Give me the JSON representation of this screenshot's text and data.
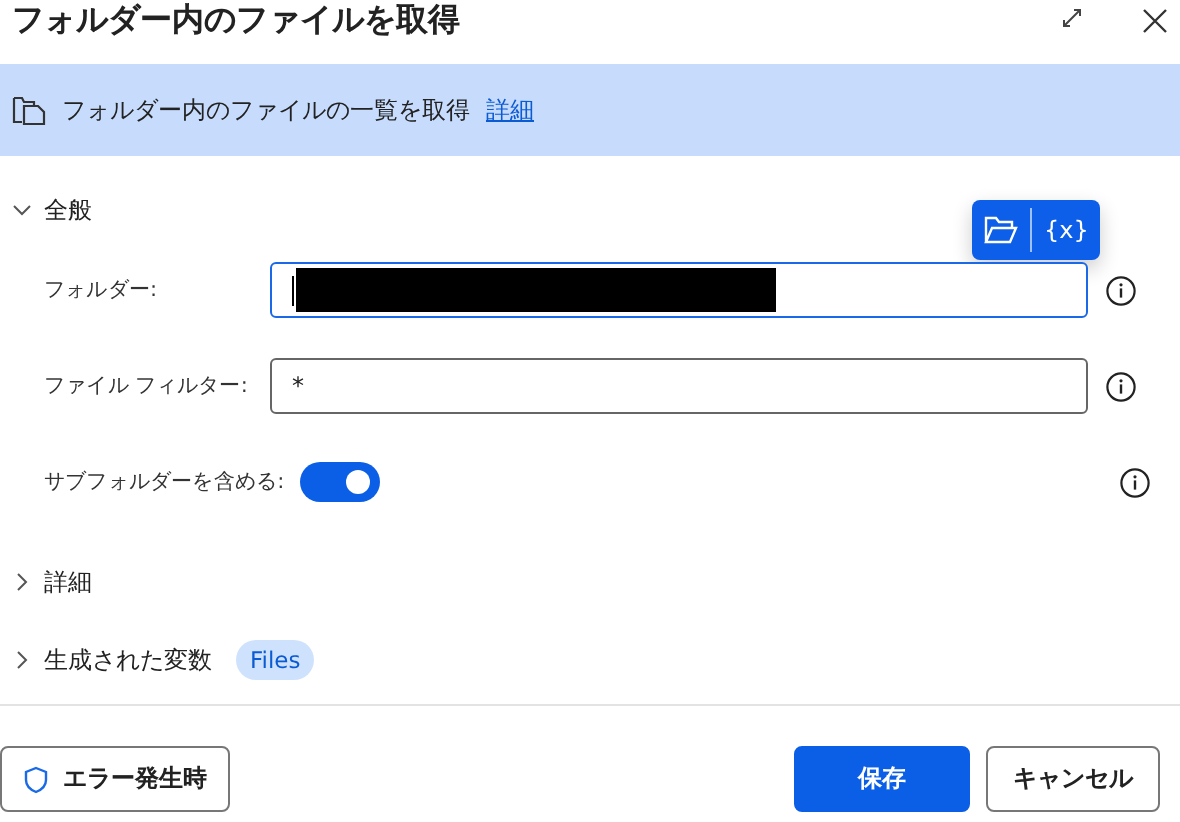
{
  "dialog": {
    "title": "フォルダー内のファイルを取得"
  },
  "banner": {
    "text": "フォルダー内のファイルの一覧を取得",
    "link": "詳細"
  },
  "sections": [
    {
      "label": "全般",
      "expanded": true,
      "fields": [
        {
          "kind": "text",
          "label": "フォルダー:",
          "focused": true,
          "redacted": true,
          "toolbar": {
            "variable_button": "{x}"
          }
        },
        {
          "kind": "text",
          "label": "ファイル フィルター:",
          "value": "*",
          "focused": false
        },
        {
          "kind": "toggle",
          "label": "サブフォルダーを含める:",
          "on": true
        }
      ]
    },
    {
      "label": "詳細",
      "expanded": false
    },
    {
      "label": "生成された変数",
      "expanded": false,
      "badges": [
        "Files"
      ]
    }
  ],
  "footer": {
    "error_button": "エラー発生時",
    "save": "保存",
    "cancel": "キャンセル"
  }
}
